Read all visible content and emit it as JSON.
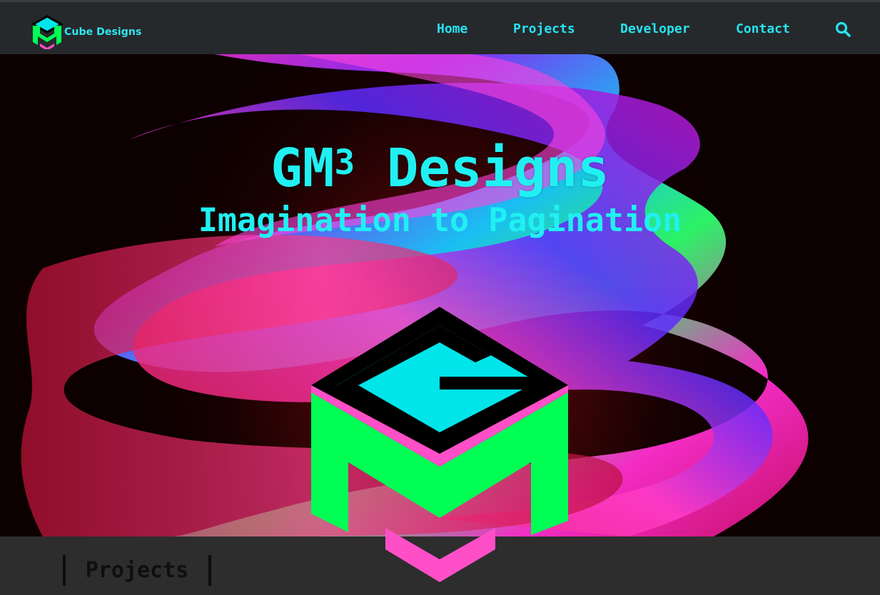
{
  "brand": {
    "name": "Cube Designs",
    "logo_icon": "gm-cube-logo-icon"
  },
  "nav": {
    "items": [
      {
        "label": "Home"
      },
      {
        "label": "Projects"
      },
      {
        "label": "Developer"
      },
      {
        "label": "Contact"
      }
    ],
    "search_icon": "search-icon"
  },
  "hero": {
    "title_main": "GM",
    "title_sup": "3",
    "title_rest": " Designs",
    "tagline": "Imagination to Pagination",
    "logo_icon": "gm-cube-logo-icon"
  },
  "section": {
    "projects_label": "Projects"
  },
  "colors": {
    "accent_cyan": "#20f0f2",
    "accent_green": "#00ff55",
    "accent_pink": "#ff4fc8",
    "navbar_bg": "#26292c",
    "section_bg": "#2d2d2d"
  }
}
